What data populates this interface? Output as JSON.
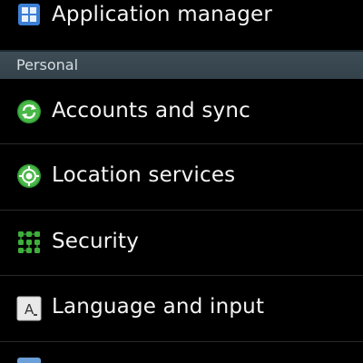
{
  "menu_top": {
    "label": "Application manager",
    "icon": "application-manager-icon"
  },
  "section": {
    "title": "Personal"
  },
  "items": [
    {
      "label": "Accounts and sync",
      "icon": "sync-icon"
    },
    {
      "label": "Location services",
      "icon": "location-icon"
    },
    {
      "label": "Security",
      "icon": "security-icon"
    },
    {
      "label": "Language and input",
      "icon": "language-icon"
    }
  ],
  "colors": {
    "background": "#000000",
    "section_header": "#3a4850",
    "text": "#f4f4f4",
    "accent_green": "#3fae3a",
    "accent_blue": "#3f7fd0"
  }
}
